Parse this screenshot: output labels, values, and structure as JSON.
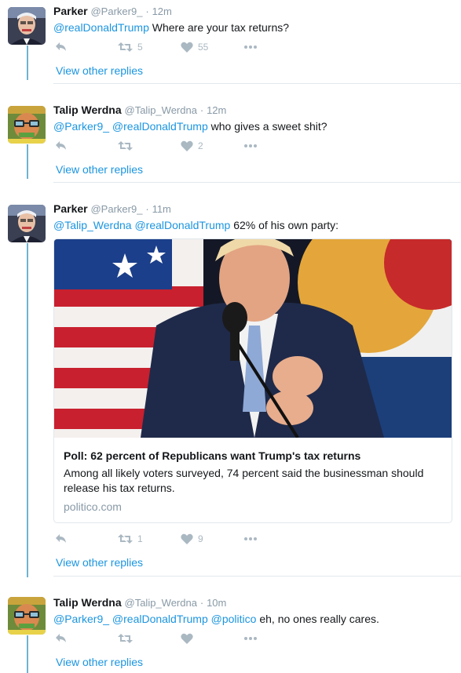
{
  "tweets": [
    {
      "name": "Parker",
      "handle": "@Parker9_",
      "time": "12m",
      "mentions": "@realDonaldTrump",
      "text": " Where are your tax returns?",
      "retweets": "5",
      "likes": "55",
      "view_replies": "View other replies",
      "avatar_icon": "bernie-avatar"
    },
    {
      "name": "Talip Werdna",
      "handle": "@Talip_Werdna",
      "time": "12m",
      "mentions": "@Parker9_ @realDonaldTrump",
      "text": " who gives a sweet shit?",
      "retweets": "",
      "likes": "2",
      "view_replies": "View other replies",
      "avatar_icon": "glasses-face-avatar"
    },
    {
      "name": "Parker",
      "handle": "@Parker9_",
      "time": "11m",
      "mentions": "@Talip_Werdna @realDonaldTrump",
      "text": " 62% of his own party:",
      "retweets": "1",
      "likes": "9",
      "view_replies": "View other replies",
      "avatar_icon": "bernie-avatar",
      "card": {
        "title": "Poll: 62 percent of Republicans want Trump's tax returns",
        "description_line1": "Among all likely voters surveyed, 74 percent said the businessman should",
        "description_line2": "release his tax returns.",
        "domain": "politico.com"
      }
    },
    {
      "name": "Talip Werdna",
      "handle": "@Talip_Werdna",
      "time": "10m",
      "mentions": "@Parker9_ @realDonaldTrump @politico",
      "text": " eh, no ones really cares.",
      "retweets": "",
      "likes": "",
      "view_replies": "View other replies",
      "avatar_icon": "glasses-face-avatar"
    }
  ],
  "separator": "·",
  "colors": {
    "link": "#1b95e0",
    "muted": "#8899a6",
    "icon": "#aab8c2",
    "thread_line": "#6fb3cf"
  }
}
